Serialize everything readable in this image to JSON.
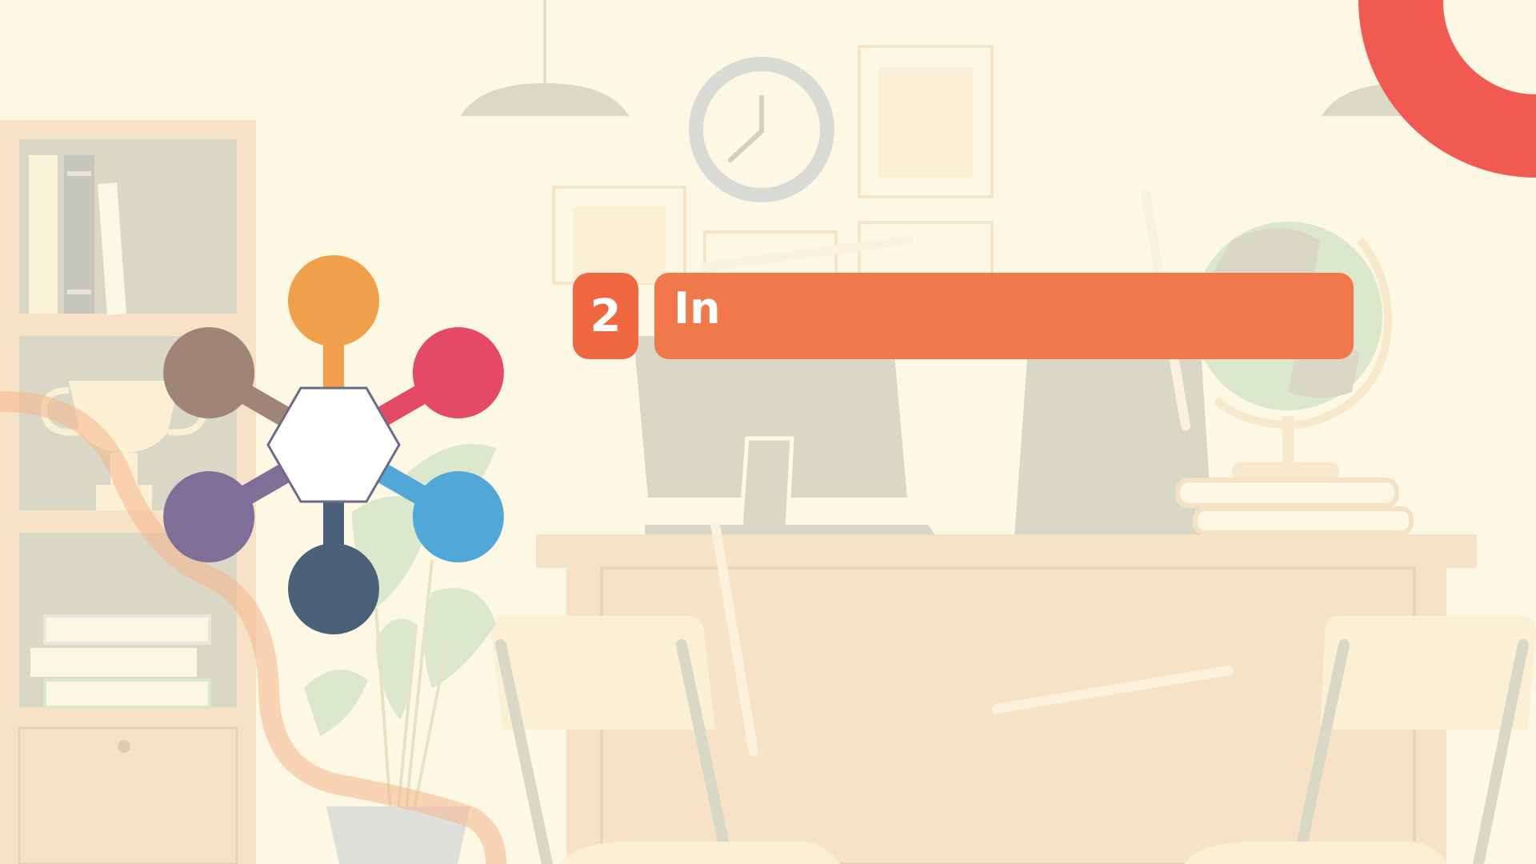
{
  "slide": {
    "step_number": "2",
    "title_text": "In"
  },
  "colors": {
    "background": "#fdf8e4",
    "accent_red": "#f05a50",
    "title_orange": "#f0784a",
    "number_orange": "#f0683f",
    "node_orange": "#f0a04a",
    "node_red": "#e54a64",
    "node_blue": "#50a8d8",
    "node_navy": "#4a6078",
    "node_purple": "#7e6e98",
    "node_brown": "#a08476"
  },
  "diagram": {
    "center": "hexagon",
    "nodes": [
      {
        "color": "#f0a04a"
      },
      {
        "color": "#e54a64"
      },
      {
        "color": "#50a8d8"
      },
      {
        "color": "#4a6078"
      },
      {
        "color": "#7e6e98"
      },
      {
        "color": "#a08476"
      }
    ]
  }
}
